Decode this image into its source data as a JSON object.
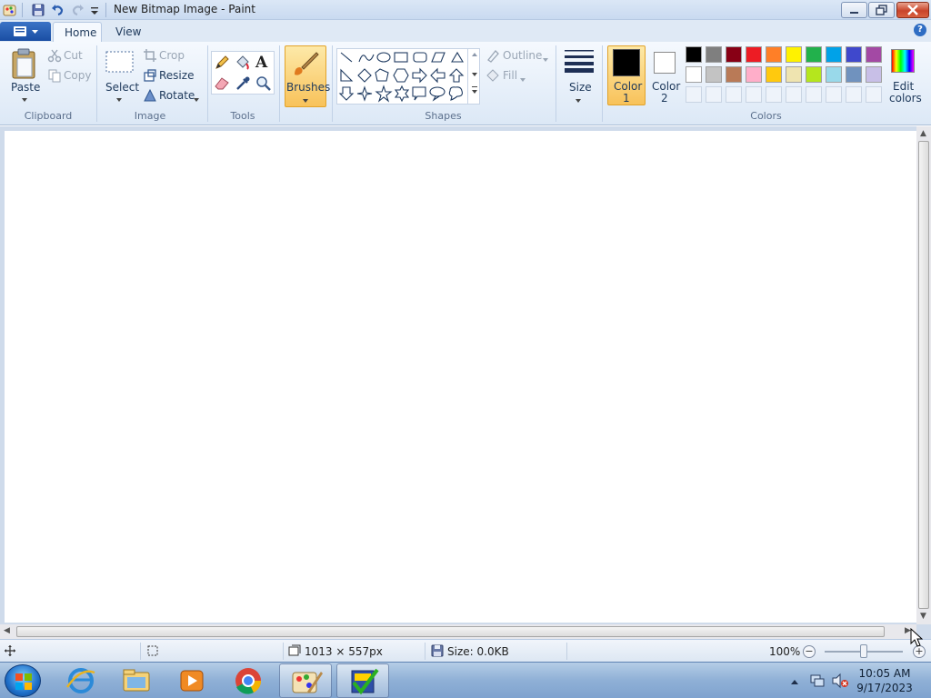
{
  "window": {
    "title": "New Bitmap Image - Paint"
  },
  "ribbon": {
    "tabs": [
      "Home",
      "View"
    ],
    "clipboard": {
      "paste": "Paste",
      "cut": "Cut",
      "copy": "Copy",
      "group": "Clipboard"
    },
    "image": {
      "select": "Select",
      "crop": "Crop",
      "resize": "Resize",
      "rotate": "Rotate",
      "group": "Image"
    },
    "tools": {
      "group": "Tools"
    },
    "brushes": "Brushes",
    "shapes": {
      "outline": "Outline",
      "fill": "Fill",
      "group": "Shapes"
    },
    "size": "Size",
    "colors": {
      "color1_line1": "Color",
      "color1_line2": "1",
      "color2_line1": "Color",
      "color2_line2": "2",
      "edit_line1": "Edit",
      "edit_line2": "colors",
      "group": "Colors",
      "color1_value": "#000000",
      "color2_value": "#ffffff",
      "palette_row1": [
        "#000000",
        "#7f7f7f",
        "#880015",
        "#ed1c24",
        "#ff7f27",
        "#fff200",
        "#22b14c",
        "#00a2e8",
        "#3f48cc",
        "#a349a4"
      ],
      "palette_row2": [
        "#ffffff",
        "#c3c3c3",
        "#b97a57",
        "#ffaec9",
        "#ffc90e",
        "#efe4b0",
        "#b5e61d",
        "#99d9ea",
        "#7092be",
        "#c8bfe7"
      ]
    }
  },
  "status": {
    "dimensions": "1013 × 557px",
    "size": "Size: 0.0KB",
    "zoom": "100%"
  },
  "taskbar": {
    "time": "10:05 AM",
    "date": "9/17/2023"
  }
}
